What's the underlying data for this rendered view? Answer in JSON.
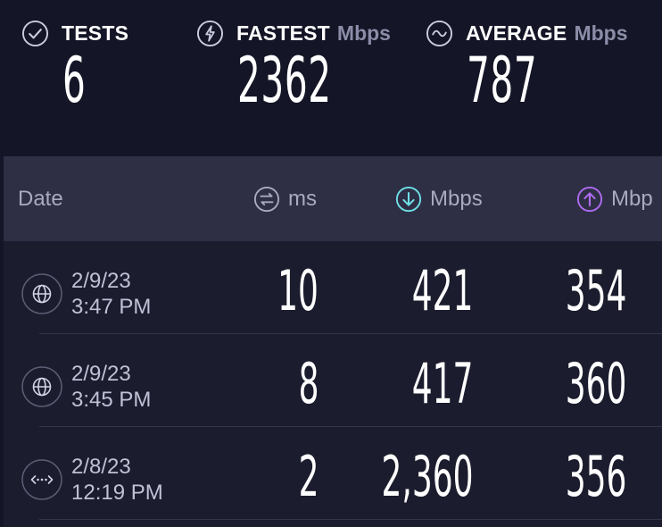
{
  "summary": {
    "tests": {
      "label": "TESTS",
      "value": "6"
    },
    "fastest": {
      "label": "FASTEST",
      "unit": "Mbps",
      "value": "2362"
    },
    "average": {
      "label": "AVERAGE",
      "unit": "Mbps",
      "value": "787"
    }
  },
  "table": {
    "columns": {
      "date": "Date",
      "ping": "ms",
      "download": "Mbps",
      "upload": "Mbp"
    },
    "rows": [
      {
        "icon": "globe-icon",
        "date": "2/9/23",
        "time": "3:47 PM",
        "ping": "10",
        "download": "421",
        "upload": "354"
      },
      {
        "icon": "globe-icon",
        "date": "2/9/23",
        "time": "3:45 PM",
        "ping": "8",
        "download": "417",
        "upload": "360"
      },
      {
        "icon": "connections-icon",
        "date": "2/8/23",
        "time": "12:19 PM",
        "ping": "2",
        "download": "2,360",
        "upload": "356"
      }
    ]
  },
  "colors": {
    "background": "#141526",
    "header_bg": "#2e2f45",
    "download_accent": "#6fe0e8",
    "upload_accent": "#b06cf0"
  }
}
